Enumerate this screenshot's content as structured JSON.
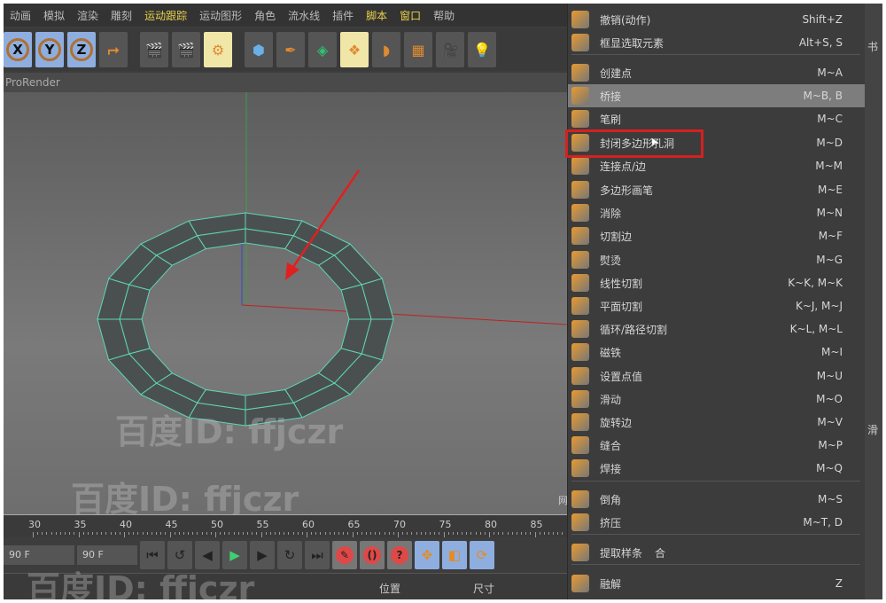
{
  "menubar": {
    "items": [
      {
        "label": "动画",
        "highlight": false
      },
      {
        "label": "模拟",
        "highlight": false
      },
      {
        "label": "渲染",
        "highlight": false
      },
      {
        "label": "雕刻",
        "highlight": false
      },
      {
        "label": "运动跟踪",
        "highlight": true
      },
      {
        "label": "运动图形",
        "highlight": false
      },
      {
        "label": "角色",
        "highlight": false
      },
      {
        "label": "流水线",
        "highlight": false
      },
      {
        "label": "插件",
        "highlight": false
      },
      {
        "label": "脚本",
        "highlight": true
      },
      {
        "label": "窗口",
        "highlight": true
      },
      {
        "label": "帮助",
        "highlight": false
      }
    ]
  },
  "toolbar": {
    "axes": [
      "X",
      "Y",
      "Z"
    ],
    "icons": [
      "coordinate-system-icon",
      "render-view-icon",
      "render-picture-viewer-icon",
      "render-settings-icon",
      "cube-icon",
      "pen-spline-icon",
      "subdivision-icon",
      "cloner-icon",
      "deformer-icon",
      "floor-icon",
      "camera-icon",
      "light-icon"
    ]
  },
  "viewport": {
    "title": "ProRender",
    "watermark": "百度ID: ffjczr",
    "side_label": "网"
  },
  "timeline": {
    "ticks": [
      "30",
      "35",
      "40",
      "45",
      "50",
      "55",
      "60",
      "65",
      "70",
      "75",
      "80",
      "85"
    ]
  },
  "transport": {
    "start_field": "90 F",
    "end_field": "90 F"
  },
  "bottom_panel": {
    "position_label": "位置",
    "size_label": "尺寸"
  },
  "context_menu": {
    "highlighted_index": 3,
    "groups": [
      [
        {
          "label": "撤销(动作)",
          "shortcut": "Shift+Z",
          "icon": "undo-icon"
        },
        {
          "label": "框显选取元素",
          "shortcut": "Alt+S, S",
          "icon": "frame-selected-icon"
        }
      ],
      [
        {
          "label": "创建点",
          "shortcut": "M~A",
          "icon": "create-point-icon"
        },
        {
          "label": "桥接",
          "shortcut": "M~B, B",
          "icon": "bridge-icon"
        },
        {
          "label": "笔刷",
          "shortcut": "M~C",
          "icon": "brush-icon"
        },
        {
          "label": "封闭多边形孔洞",
          "shortcut": "M~D",
          "icon": "close-polygon-hole-icon"
        },
        {
          "label": "连接点/边",
          "shortcut": "M~M",
          "icon": "connect-points-edges-icon"
        },
        {
          "label": "多边形画笔",
          "shortcut": "M~E",
          "icon": "polygon-pen-icon"
        },
        {
          "label": "消除",
          "shortcut": "M~N",
          "icon": "dissolve-icon"
        },
        {
          "label": "切割边",
          "shortcut": "M~F",
          "icon": "edge-cut-icon"
        },
        {
          "label": "熨烫",
          "shortcut": "M~G",
          "icon": "iron-icon"
        },
        {
          "label": "线性切割",
          "shortcut": "K~K, M~K",
          "icon": "knife-icon"
        },
        {
          "label": "平面切割",
          "shortcut": "K~J, M~J",
          "icon": "plane-cut-icon"
        },
        {
          "label": "循环/路径切割",
          "shortcut": "K~L, M~L",
          "icon": "loop-cut-icon"
        },
        {
          "label": "磁铁",
          "shortcut": "M~I",
          "icon": "magnet-icon"
        },
        {
          "label": "设置点值",
          "shortcut": "M~U",
          "icon": "set-point-value-icon"
        },
        {
          "label": "滑动",
          "shortcut": "M~O",
          "icon": "slide-icon"
        },
        {
          "label": "旋转边",
          "shortcut": "M~V",
          "icon": "spin-edge-icon"
        },
        {
          "label": "缝合",
          "shortcut": "M~P",
          "icon": "stitch-icon"
        },
        {
          "label": "焊接",
          "shortcut": "M~Q",
          "icon": "weld-icon"
        }
      ],
      [
        {
          "label": "倒角",
          "shortcut": "M~S",
          "icon": "bevel-icon"
        },
        {
          "label": "挤压",
          "shortcut": "M~T, D",
          "icon": "extrude-icon"
        }
      ],
      [
        {
          "label": "提取样条",
          "shortcut": "",
          "icon": "extract-spline-icon"
        },
        {
          "label": "融解",
          "shortcut": "Z",
          "icon": "melt-icon"
        }
      ]
    ],
    "extra_fragment": "合"
  },
  "side_panel": {
    "labels": [
      "书",
      "滑"
    ]
  },
  "colors": {
    "highlight_box": "#d62020",
    "mesh": "#5fd6b4",
    "menu_active": "#7d7d7d"
  }
}
